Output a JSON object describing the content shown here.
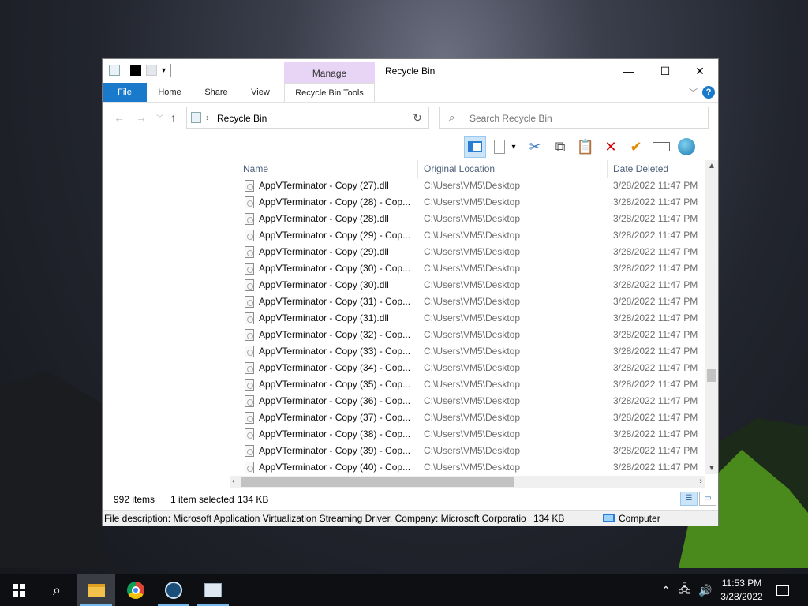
{
  "window": {
    "title": "Recycle Bin",
    "context_group": "Manage",
    "minimize": "—",
    "maximize": "☐",
    "close": "✕"
  },
  "ribbon": {
    "tabs": [
      {
        "label": "File"
      },
      {
        "label": "Home"
      },
      {
        "label": "Share"
      },
      {
        "label": "View"
      },
      {
        "label": "Recycle Bin Tools"
      }
    ],
    "help": "?"
  },
  "address": {
    "crumb": "Recycle Bin",
    "search_placeholder": "Search Recycle Bin"
  },
  "columns": {
    "name": "Name",
    "location": "Original Location",
    "date": "Date Deleted"
  },
  "files": [
    {
      "name": "AppVTerminator - Copy (27).dll",
      "location": "C:\\Users\\VM5\\Desktop",
      "date": "3/28/2022 11:47 PM"
    },
    {
      "name": "AppVTerminator - Copy (28) - Cop...",
      "location": "C:\\Users\\VM5\\Desktop",
      "date": "3/28/2022 11:47 PM"
    },
    {
      "name": "AppVTerminator - Copy (28).dll",
      "location": "C:\\Users\\VM5\\Desktop",
      "date": "3/28/2022 11:47 PM"
    },
    {
      "name": "AppVTerminator - Copy (29) - Cop...",
      "location": "C:\\Users\\VM5\\Desktop",
      "date": "3/28/2022 11:47 PM"
    },
    {
      "name": "AppVTerminator - Copy (29).dll",
      "location": "C:\\Users\\VM5\\Desktop",
      "date": "3/28/2022 11:47 PM"
    },
    {
      "name": "AppVTerminator - Copy (30) - Cop...",
      "location": "C:\\Users\\VM5\\Desktop",
      "date": "3/28/2022 11:47 PM"
    },
    {
      "name": "AppVTerminator - Copy (30).dll",
      "location": "C:\\Users\\VM5\\Desktop",
      "date": "3/28/2022 11:47 PM"
    },
    {
      "name": "AppVTerminator - Copy (31) - Cop...",
      "location": "C:\\Users\\VM5\\Desktop",
      "date": "3/28/2022 11:47 PM"
    },
    {
      "name": "AppVTerminator - Copy (31).dll",
      "location": "C:\\Users\\VM5\\Desktop",
      "date": "3/28/2022 11:47 PM"
    },
    {
      "name": "AppVTerminator - Copy (32) - Cop...",
      "location": "C:\\Users\\VM5\\Desktop",
      "date": "3/28/2022 11:47 PM"
    },
    {
      "name": "AppVTerminator - Copy (33) - Cop...",
      "location": "C:\\Users\\VM5\\Desktop",
      "date": "3/28/2022 11:47 PM"
    },
    {
      "name": "AppVTerminator - Copy (34) - Cop...",
      "location": "C:\\Users\\VM5\\Desktop",
      "date": "3/28/2022 11:47 PM"
    },
    {
      "name": "AppVTerminator - Copy (35) - Cop...",
      "location": "C:\\Users\\VM5\\Desktop",
      "date": "3/28/2022 11:47 PM"
    },
    {
      "name": "AppVTerminator - Copy (36) - Cop...",
      "location": "C:\\Users\\VM5\\Desktop",
      "date": "3/28/2022 11:47 PM"
    },
    {
      "name": "AppVTerminator - Copy (37) - Cop...",
      "location": "C:\\Users\\VM5\\Desktop",
      "date": "3/28/2022 11:47 PM"
    },
    {
      "name": "AppVTerminator - Copy (38) - Cop...",
      "location": "C:\\Users\\VM5\\Desktop",
      "date": "3/28/2022 11:47 PM"
    },
    {
      "name": "AppVTerminator - Copy (39) - Cop...",
      "location": "C:\\Users\\VM5\\Desktop",
      "date": "3/28/2022 11:47 PM"
    },
    {
      "name": "AppVTerminator - Copy (40) - Cop...",
      "location": "C:\\Users\\VM5\\Desktop",
      "date": "3/28/2022 11:47 PM"
    }
  ],
  "status": {
    "count": "992 items",
    "selected": "1 item selected",
    "size": "134 KB"
  },
  "details": {
    "description": "File description: Microsoft Application Virtualization Streaming Driver, Company: Microsoft Corporatio",
    "size": "134 KB",
    "zone": "Computer"
  },
  "taskbar": {
    "time": "11:53 PM",
    "date": "3/28/2022",
    "apps": [
      "start-icon",
      "search-icon",
      "file-explorer-icon",
      "chrome-icon",
      "steam-icon",
      "image-viewer-icon"
    ]
  },
  "colors": {
    "accent": "#1979ca",
    "manage_bg": "#e8d4f4",
    "delete_red": "#d00000",
    "restore_orange": "#e08a00"
  }
}
